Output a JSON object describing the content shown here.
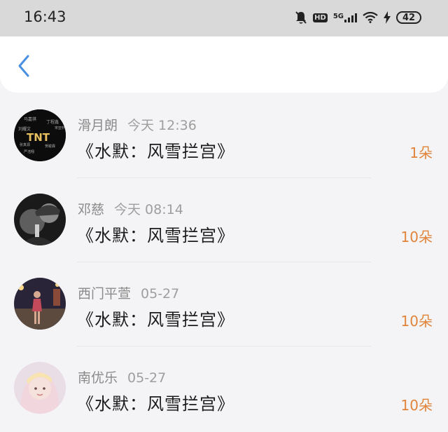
{
  "status_bar": {
    "time": "16:43",
    "network": "5G",
    "hd": "HD",
    "battery": "42",
    "icons": [
      "mute-icon",
      "hd-icon",
      "signal-5g-icon",
      "wifi-icon",
      "charging-icon",
      "battery-icon"
    ]
  },
  "nav": {
    "back_icon": "chevron-left-icon"
  },
  "colors": {
    "accent": "#e0843b",
    "back": "#4a90e2"
  },
  "items": [
    {
      "name": "滑月朗",
      "time": "今天 12:36",
      "title": "《水默：风雪拦宫》",
      "count": "1朵",
      "avatar_text": "TNT"
    },
    {
      "name": "邓慈",
      "time": "今天 08:14",
      "title": "《水默：风雪拦宫》",
      "count": "10朵"
    },
    {
      "name": "西门平萱",
      "time": "05-27",
      "title": "《水默：风雪拦宫》",
      "count": "10朵"
    },
    {
      "name": "南优乐",
      "time": "05-27",
      "title": "《水默：风雪拦宫》",
      "count": "10朵"
    }
  ]
}
